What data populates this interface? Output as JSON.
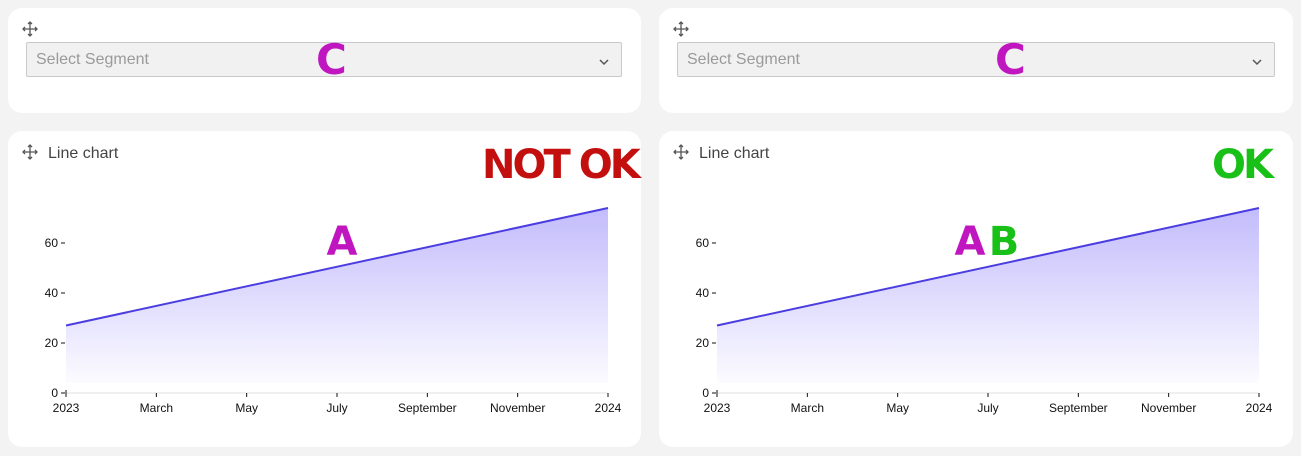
{
  "segment_selects": [
    {
      "placeholder": "Select Segment",
      "marker": "C"
    },
    {
      "placeholder": "Select Segment",
      "marker": "C"
    }
  ],
  "charts": [
    {
      "title": "Line chart",
      "status": "NOT OK",
      "markers": [
        "A"
      ]
    },
    {
      "title": "Line chart",
      "status": "OK",
      "markers": [
        "A",
        "B"
      ]
    }
  ],
  "colors": {
    "line": "#4b3de0",
    "area_top": "#b8b0fb",
    "marker_magenta": "#c016c0",
    "marker_green": "#18c018",
    "status_bad": "#c40f0f",
    "status_good": "#18c018"
  },
  "icons": {
    "move": "move-arrows-icon",
    "dropdown": "chevron-down-icon"
  },
  "chart_data": [
    {
      "type": "area",
      "x": [
        "2023-01-01",
        "2024-01-01"
      ],
      "y": [
        27,
        74
      ],
      "x_ticks": [
        "2023",
        "March",
        "May",
        "July",
        "September",
        "November",
        "2024"
      ],
      "y_ticks": [
        "0",
        "20",
        "40",
        "60"
      ],
      "ylim": [
        0,
        80
      ],
      "grid": false,
      "annotations": [
        "A"
      ]
    },
    {
      "type": "area",
      "x": [
        "2023-01-01",
        "2024-01-01"
      ],
      "y": [
        27,
        74
      ],
      "x_ticks": [
        "2023",
        "March",
        "May",
        "July",
        "September",
        "November",
        "2024"
      ],
      "y_ticks": [
        "0",
        "20",
        "40",
        "60"
      ],
      "ylim": [
        0,
        80
      ],
      "grid": false,
      "annotations": [
        "A",
        "B"
      ]
    }
  ]
}
